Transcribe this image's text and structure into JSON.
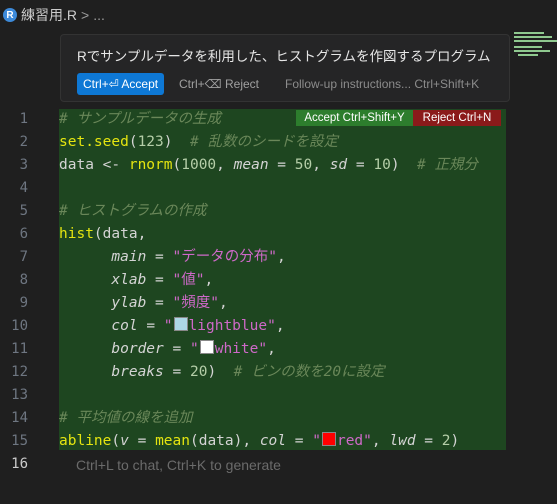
{
  "breadcrumb": {
    "file": "練習用.R",
    "separator": ">",
    "ellipsis": "..."
  },
  "inline_chat": {
    "prompt": "Rでサンプルデータを利用した、ヒストグラムを作図するプログラム",
    "accept_label": "Ctrl+⏎ Accept",
    "reject_label": "Ctrl+⌫ Reject",
    "followup_label": "Follow-up instructions... Ctrl+Shift+K"
  },
  "diff_actions": {
    "accept_label": "Accept Ctrl+Shift+Y",
    "reject_label": "Reject Ctrl+N"
  },
  "line_numbers": [
    "1",
    "2",
    "3",
    "4",
    "5",
    "6",
    "7",
    "8",
    "9",
    "10",
    "11",
    "12",
    "13",
    "14",
    "15",
    "16"
  ],
  "code": {
    "l1": "# サンプルデータの生成",
    "l2_fn": "set.seed",
    "l2_arg": "123",
    "l2_cmt": "# 乱数のシードを設定",
    "l3_a": "data <- ",
    "l3_fn": "rnorm",
    "l3_n": "1000",
    "l3_mean": "mean",
    "l3_mv": "50",
    "l3_sd": "sd",
    "l3_sv": "10",
    "l3_cmt": "# 正規分",
    "l5": "# ヒストグラムの作成",
    "l6_fn": "hist",
    "l6_arg": "data,",
    "l7_k": "main",
    "l7_v": "\"データの分布\"",
    "l8_k": "xlab",
    "l8_v": "\"値\"",
    "l9_k": "ylab",
    "l9_v": "\"頻度\"",
    "l10_k": "col",
    "l10_v": "lightblue",
    "l11_k": "border",
    "l11_v": "white",
    "l12_k": "breaks",
    "l12_v": "20",
    "l12_cmt": "# ビンの数を20に設定",
    "l14": "# 平均値の線を追加",
    "l15_fn": "abline",
    "l15_v": "v",
    "l15_mean": "mean",
    "l15_col": "col",
    "l15_colv": "red",
    "l15_lwd": "lwd",
    "l15_lwdv": "2"
  },
  "hint": "Ctrl+L to chat, Ctrl+K to generate",
  "colors": {
    "diff_background": "#1e4620",
    "accept_badge": "#2d7d2d",
    "reject_badge": "#8b1a1a",
    "primary_button": "#0e78d5",
    "swatch_lightblue": "#add8e6",
    "swatch_white": "#ffffff",
    "swatch_red": "#ff0000"
  }
}
